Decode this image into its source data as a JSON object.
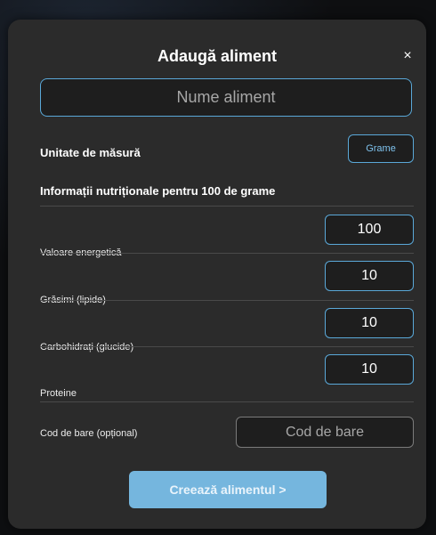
{
  "modal": {
    "title": "Adaugă aliment",
    "close_label": "×"
  },
  "name_field": {
    "placeholder": "Nume aliment",
    "value": ""
  },
  "unit": {
    "label": "Unitate de măsură",
    "button_label": "Grame"
  },
  "nutrition": {
    "section_title": "Informații nutriționale pentru 100 de grame",
    "rows": [
      {
        "label": "Valoare energetică",
        "value": "100"
      },
      {
        "label": "Grăsimi (lipide)",
        "value": "10"
      },
      {
        "label": "Carbohidrați (glucide)",
        "value": "10"
      },
      {
        "label": "Proteine",
        "value": "10"
      }
    ]
  },
  "barcode": {
    "label": "Cod de bare (opțional)",
    "placeholder": "Cod de bare",
    "value": ""
  },
  "submit": {
    "label": "Creează alimentul >"
  },
  "colors": {
    "accent": "#5aa8d8",
    "submit_bg": "#75b6de",
    "modal_bg": "#2b2b2b"
  }
}
